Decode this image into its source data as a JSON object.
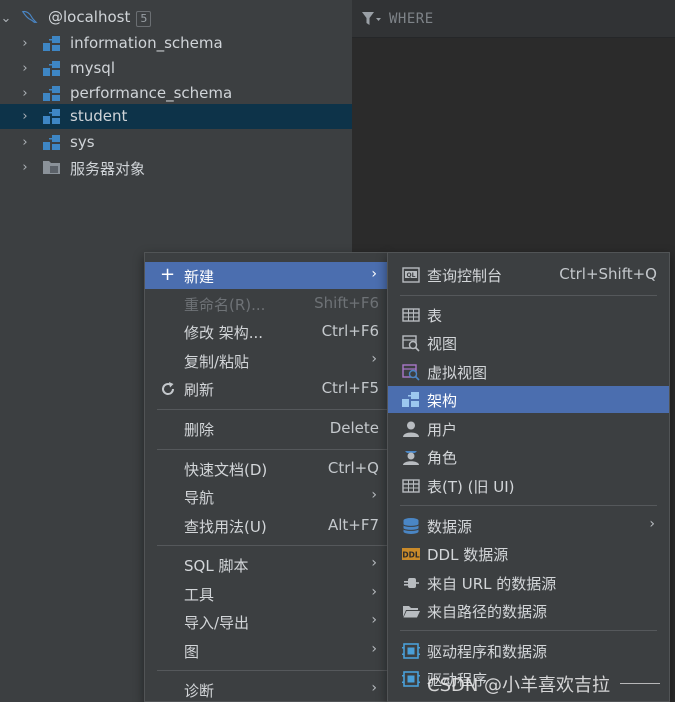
{
  "tree": {
    "host_label": "@localhost",
    "host_badge": "5",
    "items": [
      {
        "label": "information_schema"
      },
      {
        "label": "mysql"
      },
      {
        "label": "performance_schema"
      },
      {
        "label": "student"
      },
      {
        "label": "sys"
      },
      {
        "label": "服务器对象"
      }
    ]
  },
  "editor": {
    "filter_label": "WHERE"
  },
  "context_menu": {
    "items": [
      {
        "label": "新建",
        "shortcut": "",
        "submenu": true
      },
      {
        "label": "重命名(R)...",
        "shortcut": "Shift+F6"
      },
      {
        "label": "修改 架构...",
        "shortcut": "Ctrl+F6"
      },
      {
        "label": "复制/粘贴",
        "shortcut": "",
        "submenu": true
      },
      {
        "label": "刷新",
        "shortcut": "Ctrl+F5"
      },
      {
        "label": "删除",
        "shortcut": "Delete"
      },
      {
        "label": "快速文档(D)",
        "shortcut": "Ctrl+Q"
      },
      {
        "label": "导航",
        "shortcut": "",
        "submenu": true
      },
      {
        "label": "查找用法(U)",
        "shortcut": "Alt+F7"
      },
      {
        "label": "SQL 脚本",
        "shortcut": "",
        "submenu": true
      },
      {
        "label": "工具",
        "shortcut": "",
        "submenu": true
      },
      {
        "label": "导入/导出",
        "shortcut": "",
        "submenu": true
      },
      {
        "label": "图",
        "shortcut": "",
        "submenu": true
      },
      {
        "label": "诊断",
        "shortcut": "",
        "submenu": true
      }
    ]
  },
  "new_submenu": {
    "items": [
      {
        "label": "查询控制台",
        "shortcut": "Ctrl+Shift+Q"
      },
      {
        "label": "表"
      },
      {
        "label": "视图"
      },
      {
        "label": "虚拟视图"
      },
      {
        "label": "架构"
      },
      {
        "label": "用户"
      },
      {
        "label": "角色"
      },
      {
        "label": "表(T) (旧 UI)"
      },
      {
        "label": "数据源",
        "submenu": true
      },
      {
        "label": "DDL 数据源"
      },
      {
        "label": "来自 URL 的数据源"
      },
      {
        "label": "来自路径的数据源"
      },
      {
        "label": "驱动程序和数据源"
      },
      {
        "label": "驱动程序"
      }
    ]
  },
  "watermark": "CSDN @小羊喜欢吉拉",
  "colors": {
    "menu_highlight": "#4b6eaf",
    "tree_selection": "#0d3349",
    "schema_icon": "#3e86c4"
  }
}
